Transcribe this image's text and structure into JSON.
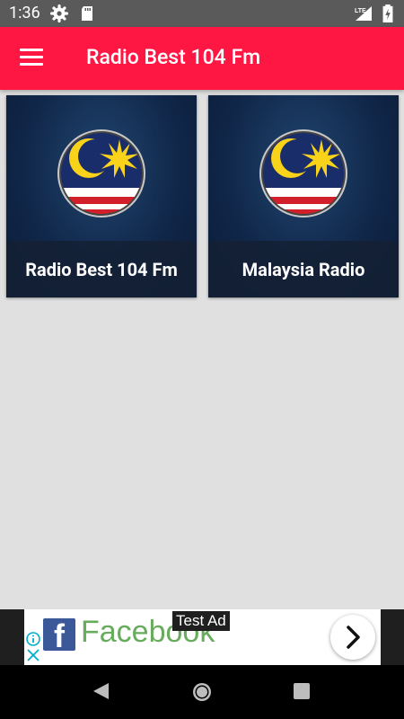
{
  "status_bar": {
    "time": "1:36",
    "left_icons": [
      "gear-icon",
      "sd-card-icon"
    ],
    "right_icons": [
      "lte-signal-icon",
      "battery-charging-icon"
    ],
    "network_label": "LTE"
  },
  "app_bar": {
    "title": "Radio Best 104 Fm",
    "menu_icon": "hamburger-menu-icon",
    "background": "#ff1744"
  },
  "stations": [
    {
      "label": "Radio Best 104 Fm",
      "icon": "malaysia-flag-icon"
    },
    {
      "label": "Malaysia Radio",
      "icon": "malaysia-flag-icon"
    }
  ],
  "ad": {
    "tag": "Test Ad",
    "brand": "Facebook",
    "brand_icon": "facebook-logo-icon",
    "action_icon": "chevron-right-icon",
    "info_icons": [
      "info-icon",
      "close-x-icon"
    ]
  },
  "nav_bar": {
    "icons": [
      "back-triangle-icon",
      "home-circle-icon",
      "recents-square-icon"
    ]
  }
}
